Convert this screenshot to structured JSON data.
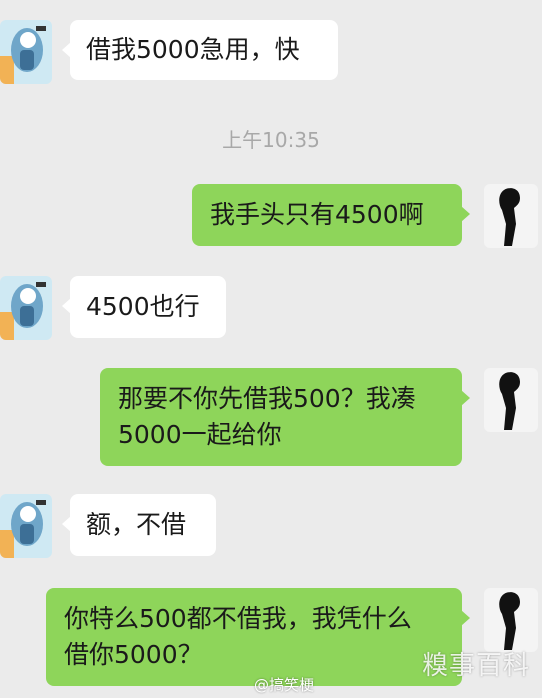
{
  "chat": {
    "timestamp": "上午10:35",
    "messages": [
      {
        "side": "in",
        "lines": [
          "借我5000急用，快"
        ]
      },
      {
        "side": "out",
        "lines": [
          "我手头只有4500啊"
        ]
      },
      {
        "side": "in",
        "lines": [
          "4500也行"
        ]
      },
      {
        "side": "out",
        "lines": [
          "那要不你先借我500？我凑",
          "5000一起给你"
        ]
      },
      {
        "side": "in",
        "lines": [
          "额，不借"
        ]
      },
      {
        "side": "out",
        "lines": [
          "你特么500都不借我，我凭什么",
          "借你5000？"
        ]
      }
    ]
  },
  "watermark": {
    "source": "@搞笑梗",
    "logo": "糗事百科"
  },
  "colors": {
    "background": "#ebebeb",
    "outgoing_bubble": "#8ed55a",
    "incoming_bubble": "#ffffff"
  }
}
